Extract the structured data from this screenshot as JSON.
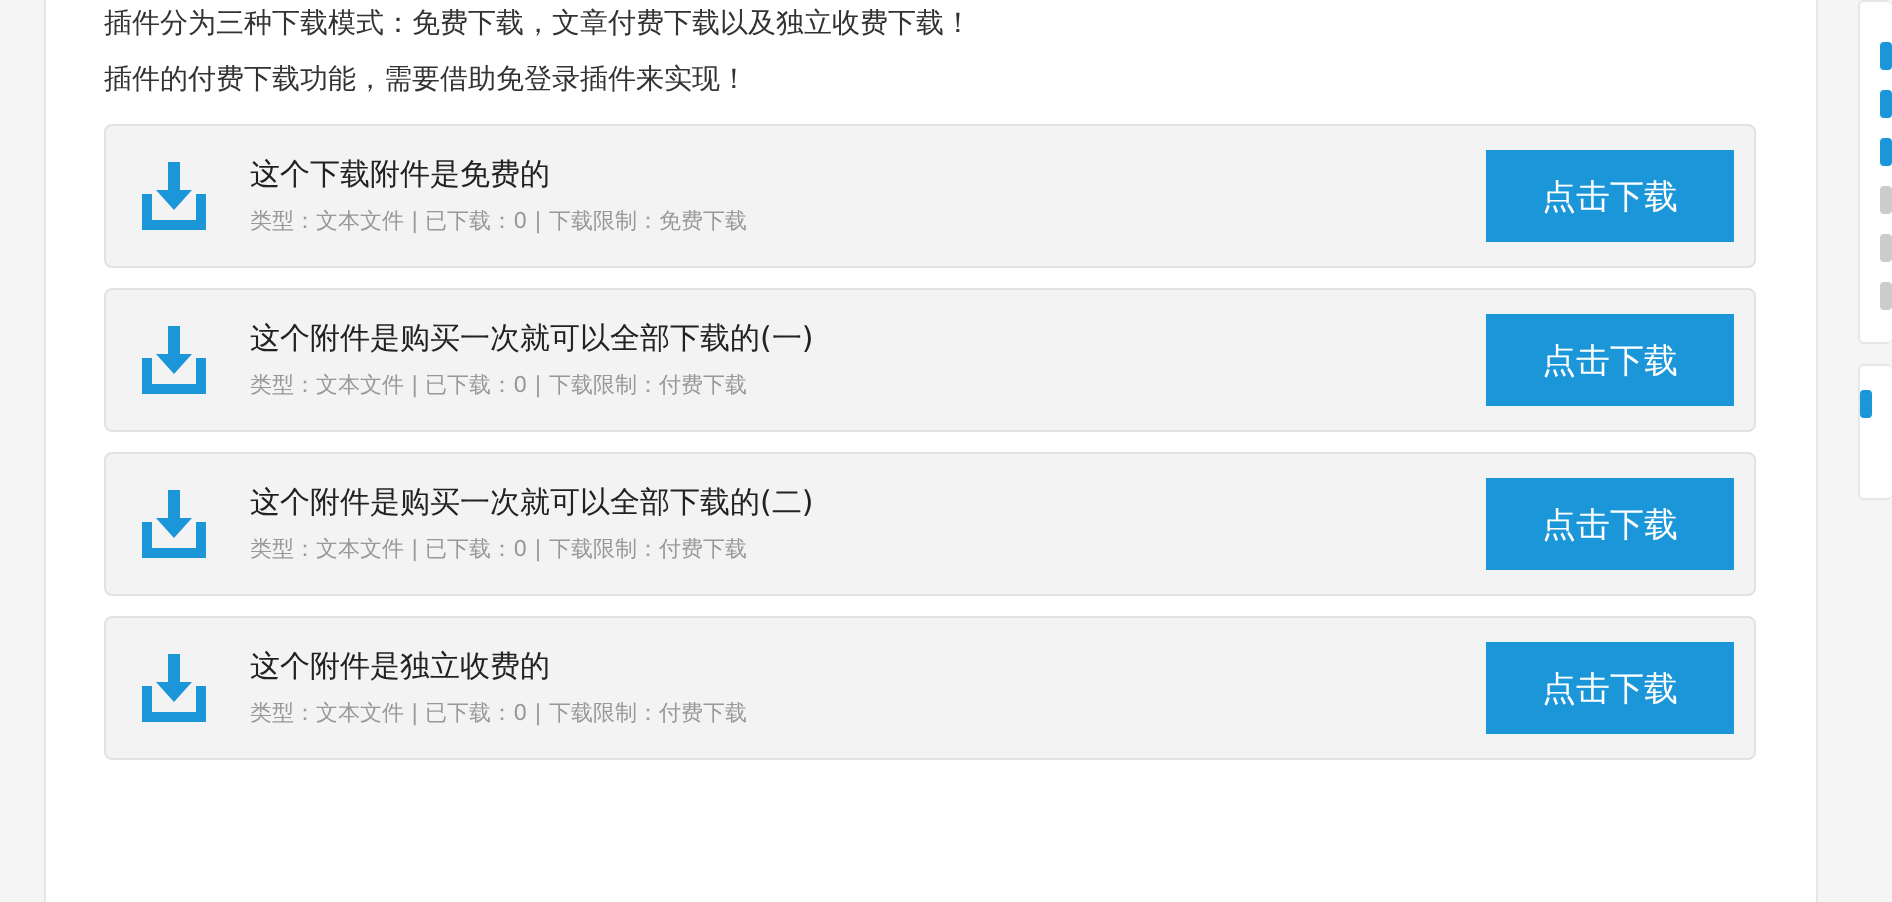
{
  "intro": [
    "插件分为三种下载模式：免费下载，文章付费下载以及独立收费下载！",
    "插件的付费下载功能，需要借助免登录插件来实现！"
  ],
  "downloads": [
    {
      "title": "这个下载附件是免费的",
      "meta": "类型：文本文件 | 已下载：0 | 下载限制：免费下载",
      "button": "点击下载"
    },
    {
      "title": "这个附件是购买一次就可以全部下载的(一)",
      "meta": "类型：文本文件 | 已下载：0 | 下载限制：付费下载",
      "button": "点击下载"
    },
    {
      "title": "这个附件是购买一次就可以全部下载的(二)",
      "meta": "类型：文本文件 | 已下载：0 | 下载限制：付费下载",
      "button": "点击下载"
    },
    {
      "title": "这个附件是独立收费的",
      "meta": "类型：文本文件 | 已下载：0 | 下载限制：付费下载",
      "button": "点击下载"
    }
  ]
}
